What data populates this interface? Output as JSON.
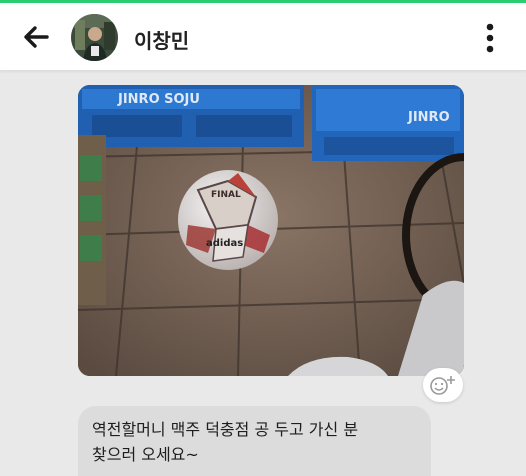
{
  "header": {
    "back_icon": "back-arrow-icon",
    "contact_name": "이창민",
    "menu_icon": "more-vertical-icon",
    "accent_color": "#2ecc71"
  },
  "message_photo": {
    "description_icon": "photo-message",
    "crate_labels": [
      "JINRO SOJU",
      "JINRO"
    ],
    "ball_brand": "adidas",
    "ball_text": "FINAL"
  },
  "reaction_icon": "add-reaction-icon",
  "message_text": {
    "line1": "역전할머니 맥주 덕충점 공 두고 가신 분",
    "line2": "찾으러 오세요~"
  }
}
